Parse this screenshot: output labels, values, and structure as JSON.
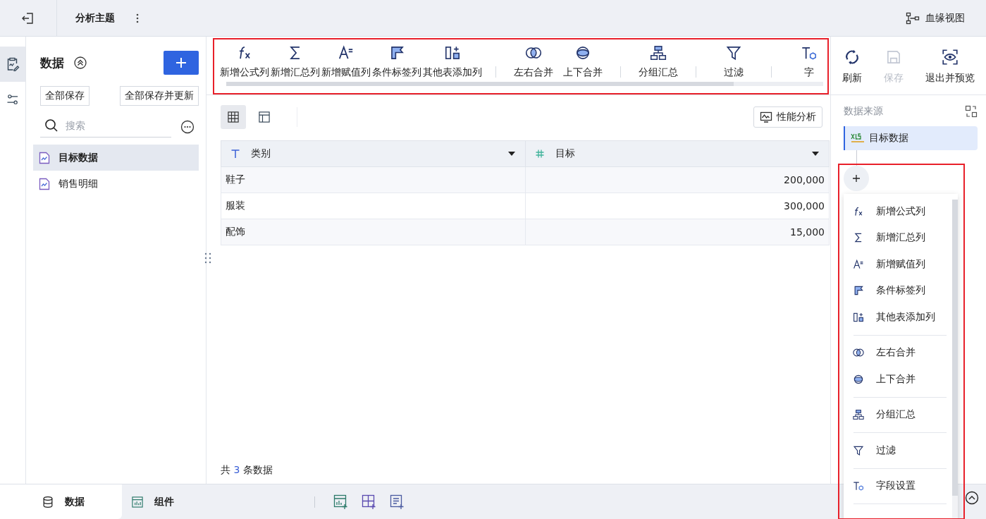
{
  "topbar": {
    "title": "分析主题",
    "lineage_label": "血缘视图"
  },
  "rail": [
    {
      "kind": "data",
      "selected": true
    },
    {
      "kind": "settings",
      "selected": false
    }
  ],
  "left_panel": {
    "title": "数据",
    "buttons": [
      "全部保存",
      "全部保存并更新"
    ],
    "search": {
      "placeholder": "搜索"
    },
    "items": [
      {
        "label": "目标数据",
        "selected": true
      },
      {
        "label": "销售明细",
        "selected": false
      }
    ]
  },
  "toolbar": {
    "highlighted": true,
    "groups": [
      [
        {
          "kind": "formula",
          "label": "新增公式列"
        },
        {
          "kind": "sum",
          "label": "新增汇总列"
        },
        {
          "kind": "assign",
          "label": "新增赋值列"
        },
        {
          "kind": "tag",
          "label": "条件标签列"
        },
        {
          "kind": "append",
          "label": "其他表添加列"
        }
      ],
      [
        {
          "kind": "join-lr",
          "label": "左右合并"
        },
        {
          "kind": "join-ud",
          "label": "上下合并"
        }
      ],
      [
        {
          "kind": "group",
          "label": "分组汇总"
        }
      ],
      [
        {
          "kind": "filter",
          "label": "过滤"
        }
      ],
      [
        {
          "kind": "field",
          "label": "字"
        }
      ]
    ],
    "actions": [
      {
        "kind": "refresh",
        "label": "刷新",
        "disabled": false
      },
      {
        "kind": "save",
        "label": "保存",
        "disabled": true
      },
      {
        "kind": "preview",
        "label": "退出并预览",
        "disabled": false
      }
    ]
  },
  "view_modes": [
    {
      "kind": "grid",
      "selected": true
    },
    {
      "kind": "layout",
      "selected": false
    }
  ],
  "perf_button": "性能分析",
  "table": {
    "columns": [
      {
        "label": "类别",
        "kind": "text"
      },
      {
        "label": "目标",
        "kind": "number"
      }
    ],
    "rows": [
      [
        "鞋子",
        "200,000"
      ],
      [
        "服装",
        "300,000"
      ],
      [
        "配饰",
        "15,000"
      ]
    ]
  },
  "footer": {
    "prefix": "共",
    "count": "3",
    "suffix": "条数据"
  },
  "source_panel": {
    "title": "数据来源",
    "sources": [
      {
        "label": "目标数据",
        "selected": true
      }
    ],
    "menu": {
      "highlighted": true,
      "groups": [
        [
          {
            "kind": "formula",
            "label": "新增公式列"
          },
          {
            "kind": "sum",
            "label": "新增汇总列"
          },
          {
            "kind": "assign",
            "label": "新增赋值列"
          },
          {
            "kind": "tag",
            "label": "条件标签列"
          },
          {
            "kind": "append",
            "label": "其他表添加列"
          }
        ],
        [
          {
            "kind": "join-lr",
            "label": "左右合并"
          },
          {
            "kind": "join-ud",
            "label": "上下合并"
          }
        ],
        [
          {
            "kind": "group",
            "label": "分组汇总"
          }
        ],
        [
          {
            "kind": "filter",
            "label": "过滤"
          }
        ],
        [
          {
            "kind": "field",
            "label": "字段设置"
          }
        ]
      ]
    }
  },
  "bottom_tabs": [
    {
      "kind": "data",
      "label": "数据",
      "selected": true
    },
    {
      "kind": "component",
      "label": "组件",
      "selected": false
    }
  ]
}
